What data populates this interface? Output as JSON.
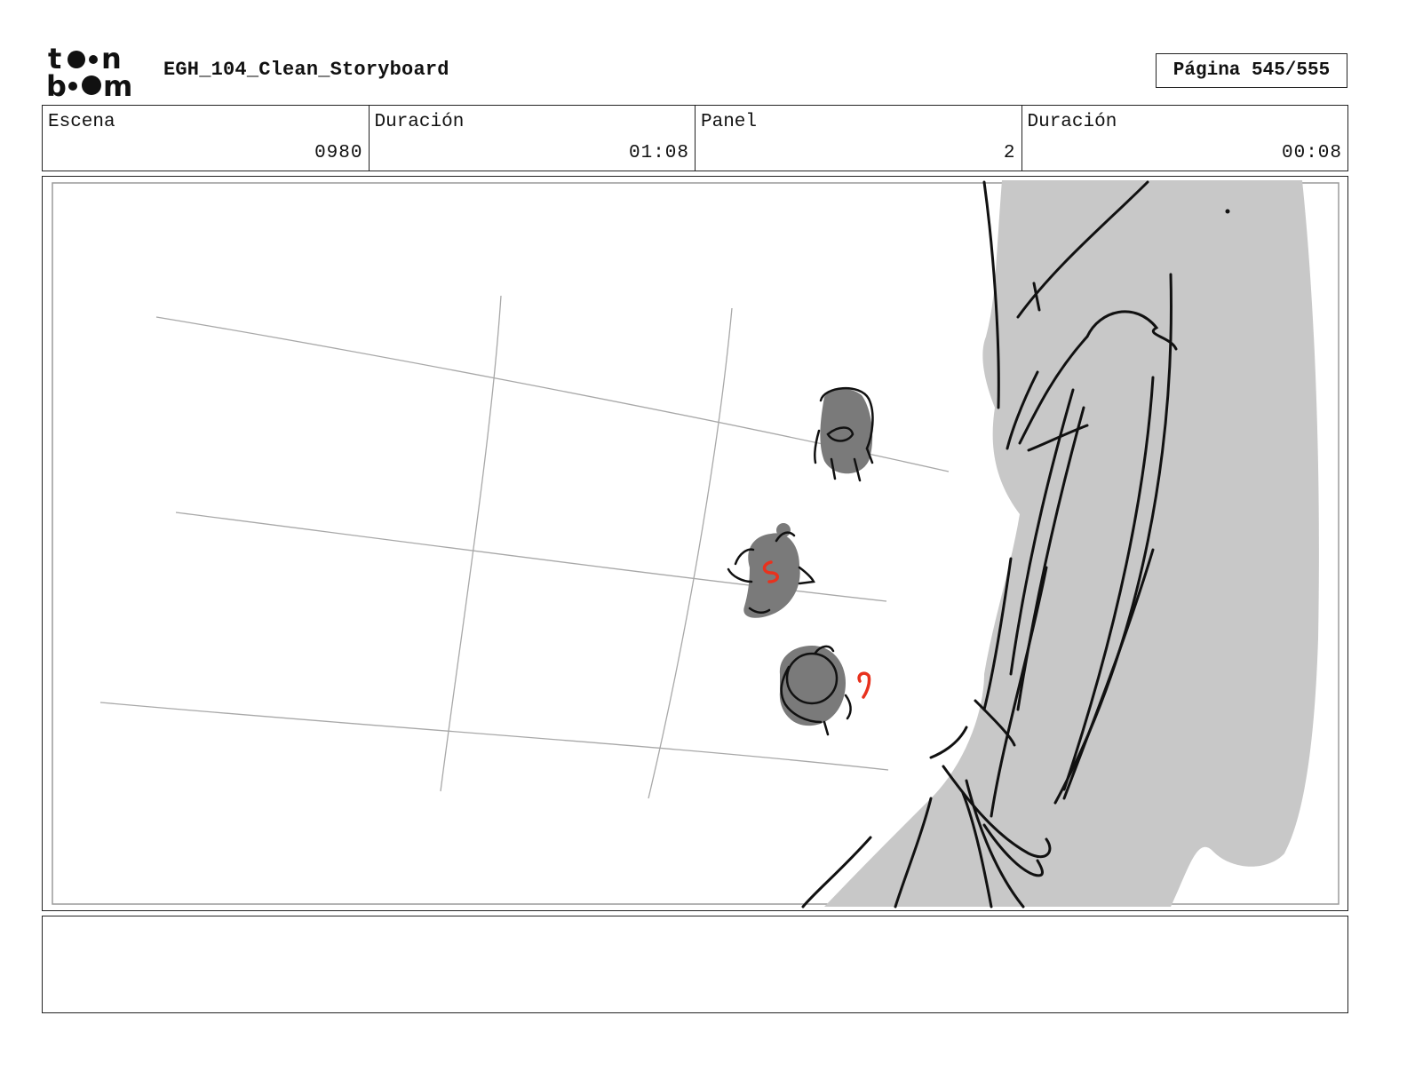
{
  "header": {
    "logo_icon": "toon-boom-logo-icon",
    "logo_text_top": "toon",
    "logo_text_bottom": "boom",
    "document_title": "EGH_104_Clean_Storyboard",
    "page_indicator": "Página 545/555"
  },
  "info": {
    "scene_label": "Escena",
    "scene_value": "0980",
    "scene_duration_label": "Duración",
    "scene_duration_value": "01:08",
    "panel_label": "Panel",
    "panel_value": "2",
    "panel_duration_label": "Duración",
    "panel_duration_value": "00:08"
  },
  "panel": {
    "sketch_icon": "storyboard-sketch-image",
    "ink_color": "#111111",
    "fill_gray": "#c8c8c8",
    "character_gray": "#7a7a7a",
    "accent_red": "#e8321e"
  },
  "notes": {
    "text": ""
  }
}
